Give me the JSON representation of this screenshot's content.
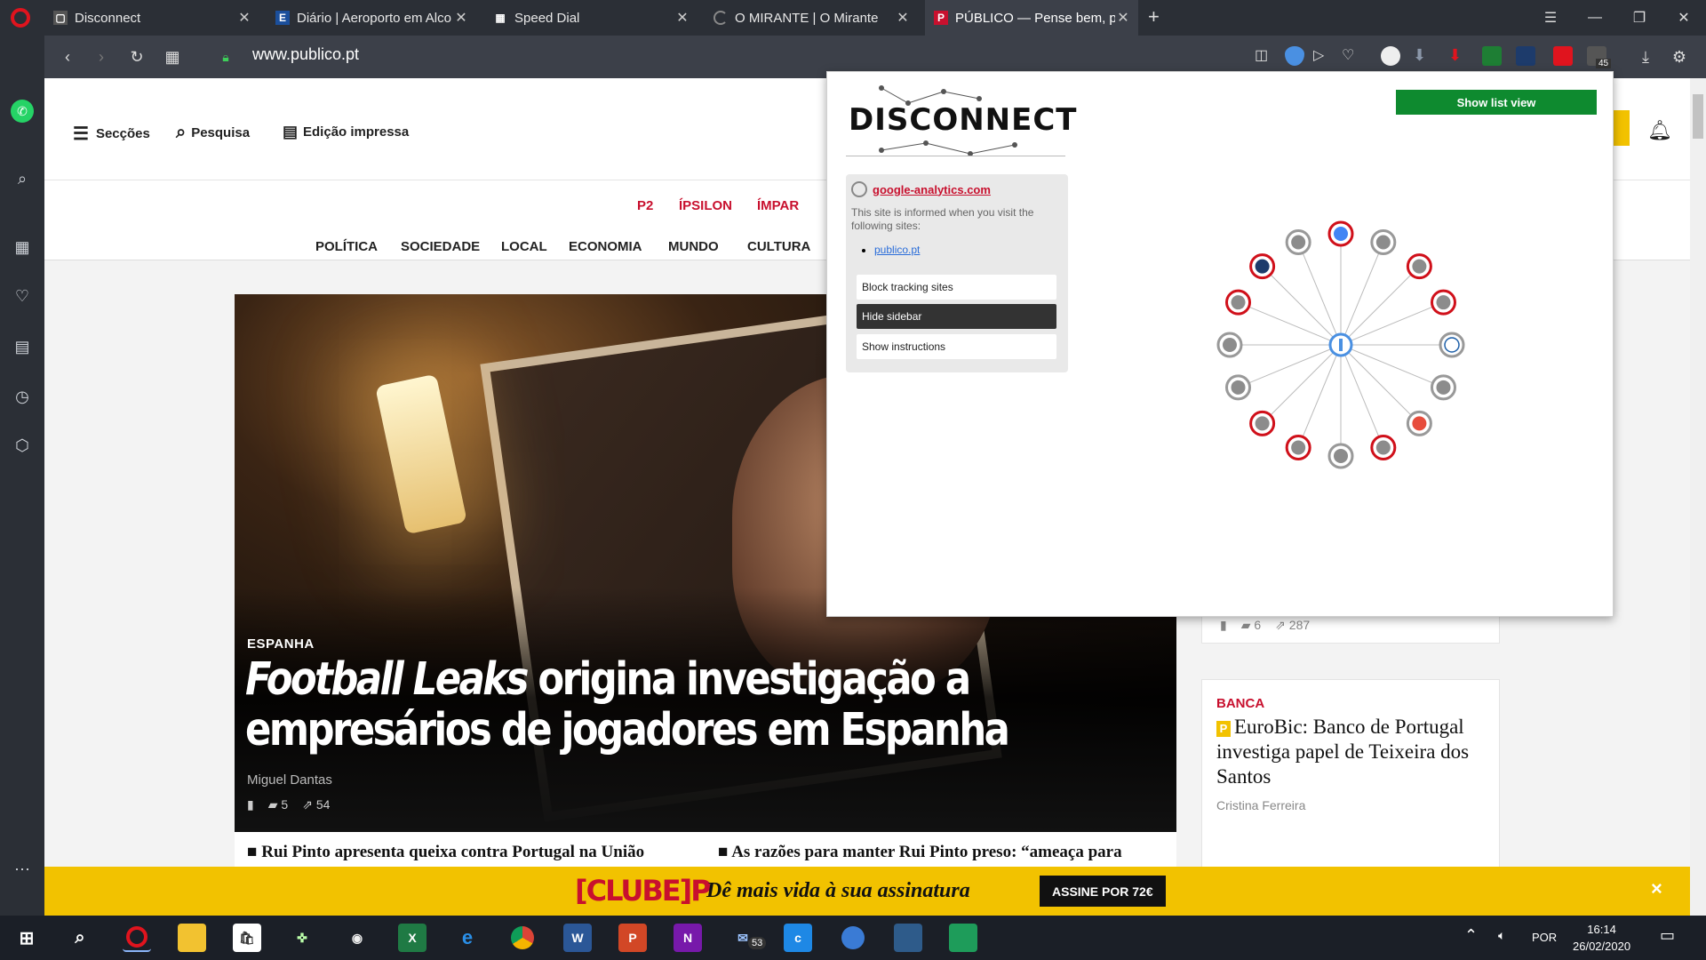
{
  "tabs": [
    {
      "title": "Disconnect",
      "icon": "disconnect-favicon"
    },
    {
      "title": "Diário | Aeroporto em Alco",
      "icon": "diario-favicon"
    },
    {
      "title": "Speed Dial",
      "icon": "speed-dial-icon"
    },
    {
      "title": "O MIRANTE | O Mirante",
      "icon": "loading-icon"
    },
    {
      "title": "PÚBLICO — Pense bem, pe",
      "icon": "publico-favicon"
    }
  ],
  "address": {
    "url": "www.publico.pt"
  },
  "extension_badge": "45",
  "site": {
    "header": {
      "sections": "Secções",
      "search": "Pesquisa",
      "print_edition": "Edição impressa"
    },
    "supplements": [
      "P2",
      "ÍPSILON",
      "ÍMPAR"
    ],
    "categories": [
      "POLÍTICA",
      "SOCIEDADE",
      "LOCAL",
      "ECONOMIA",
      "MUNDO",
      "CULTURA"
    ],
    "hero": {
      "kicker": "ESPANHA",
      "headline_italic": "Football Leaks",
      "headline_rest": " origina investigação a empresários de jogadores em Espanha",
      "author": "Miguel Dantas",
      "comments": "5",
      "shares": "54"
    },
    "subheadlines": [
      "Rui Pinto apresenta queixa contra Portugal na União",
      "As razões para manter Rui Pinto preso: “ameaça para"
    ],
    "side_meta": {
      "comments": "6",
      "shares": "287"
    },
    "side_article": {
      "kicker": "BANCA",
      "headline": "EuroBic: Banco de Portugal investiga papel de Teixeira dos Santos",
      "author": "Cristina Ferreira"
    },
    "promo": {
      "logo": "[CLUBE]P",
      "slogan": "Dê mais vida à sua assinatura",
      "cta": "ASSINE POR 72€",
      "close": "×"
    }
  },
  "disconnect": {
    "logo": "DISCONNECT",
    "list_view_button": "Show list view",
    "selected_site": "google-analytics.com",
    "description": "This site is informed when you visit the following sites:",
    "visited_sites": [
      "publico.pt"
    ],
    "buttons": [
      "Block tracking sites",
      "Hide sidebar",
      "Show instructions"
    ],
    "graph": {
      "center": "publico.pt",
      "nodes": [
        {
          "icon": "google-icon",
          "tracker": true
        },
        {
          "icon": "globe-icon",
          "tracker": false
        },
        {
          "icon": "globe-icon",
          "tracker": true
        },
        {
          "icon": "globe-icon",
          "tracker": true
        },
        {
          "icon": "w3-icon",
          "tracker": false
        },
        {
          "icon": "globe-icon",
          "tracker": false
        },
        {
          "icon": "globe-red-icon",
          "tracker": false
        },
        {
          "icon": "globe-icon",
          "tracker": true
        },
        {
          "icon": "globe-icon",
          "tracker": false
        },
        {
          "icon": "globe-icon",
          "tracker": true
        },
        {
          "icon": "globe-icon",
          "tracker": true
        },
        {
          "icon": "globe-icon",
          "tracker": false
        },
        {
          "icon": "globe-icon",
          "tracker": false
        },
        {
          "icon": "globe-icon",
          "tracker": true
        },
        {
          "icon": "site-logo-icon",
          "tracker": true
        },
        {
          "icon": "globe-icon",
          "tracker": false
        }
      ]
    }
  },
  "taskbar": {
    "language": "POR",
    "time": "16:14",
    "date": "26/02/2020",
    "mail_badge": "53"
  },
  "colors": {
    "brand_red": "#c8102e",
    "promo_yellow": "#f2c200",
    "list_button_green": "#0e8a2f",
    "tracker_ring": "#d0101a"
  }
}
